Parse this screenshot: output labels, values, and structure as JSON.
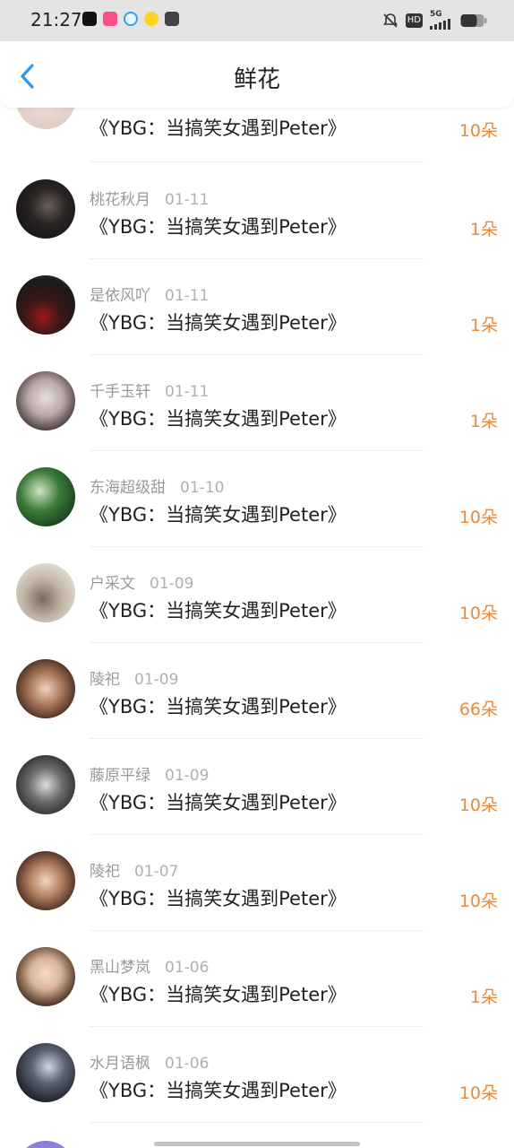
{
  "status_bar": {
    "time": "21:27",
    "app_icons": [
      "tiktok-icon",
      "music-app-icon",
      "browser-icon",
      "app-icon",
      "message-app-icon"
    ],
    "system_icons": [
      "bell-off-icon",
      "hd-icon",
      "5g-signal-icon",
      "battery-icon"
    ],
    "network_label": "5G",
    "hd_label": "HD"
  },
  "header": {
    "title": "鲜花",
    "back_icon": "chevron-left-icon"
  },
  "colors": {
    "accent": "#2f96e8",
    "count": "#e88a3a"
  },
  "records": [
    {
      "user": "",
      "date": "",
      "work": "《YBG：当搞笑女遇到Peter》",
      "count": "10朵"
    },
    {
      "user": "桃花秋月",
      "date": "01-11",
      "work": "《YBG：当搞笑女遇到Peter》",
      "count": "1朵"
    },
    {
      "user": "是依风吖",
      "date": "01-11",
      "work": "《YBG：当搞笑女遇到Peter》",
      "count": "1朵"
    },
    {
      "user": "千手玉轩",
      "date": "01-11",
      "work": "《YBG：当搞笑女遇到Peter》",
      "count": "1朵"
    },
    {
      "user": "东海超级甜",
      "date": "01-10",
      "work": "《YBG：当搞笑女遇到Peter》",
      "count": "10朵"
    },
    {
      "user": "户采文",
      "date": "01-09",
      "work": "《YBG：当搞笑女遇到Peter》",
      "count": "10朵"
    },
    {
      "user": "陵祀",
      "date": "01-09",
      "work": "《YBG：当搞笑女遇到Peter》",
      "count": "66朵"
    },
    {
      "user": "藤原平绿",
      "date": "01-09",
      "work": "《YBG：当搞笑女遇到Peter》",
      "count": "10朵"
    },
    {
      "user": "陵祀",
      "date": "01-07",
      "work": "《YBG：当搞笑女遇到Peter》",
      "count": "10朵"
    },
    {
      "user": "黑山梦岚",
      "date": "01-06",
      "work": "《YBG：当搞笑女遇到Peter》",
      "count": "1朵"
    },
    {
      "user": "水月语枫",
      "date": "01-06",
      "work": "《YBG：当搞笑女遇到Peter》",
      "count": "10朵"
    }
  ]
}
